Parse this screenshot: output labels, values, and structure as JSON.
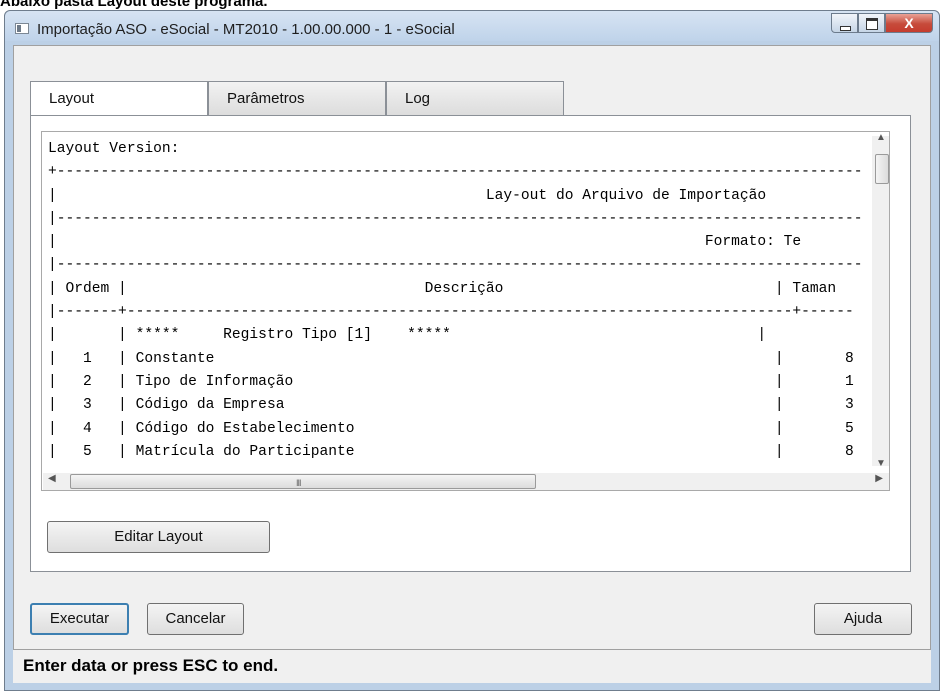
{
  "page": {
    "caption": "Abaixo pasta Layout deste programa."
  },
  "window": {
    "title": "Importação ASO - eSocial - MT2010 - 1.00.00.000 - 1 - eSocial",
    "close_label": "X"
  },
  "tabs": [
    {
      "label": "Layout"
    },
    {
      "label": "Parâmetros"
    },
    {
      "label": "Log"
    }
  ],
  "layout_text": {
    "lines": [
      "Layout Version:",
      "+--------------------------------------------------------------------------------------------",
      "|                                                 Lay-out do Arquivo de Importação",
      "|--------------------------------------------------------------------------------------------",
      "|                                                                          Formato: Te",
      "|--------------------------------------------------------------------------------------------",
      "| Ordem |                                  Descrição                               | Taman",
      "|-------+----------------------------------------------------------------------------+------",
      "|       | *****     Registro Tipo [1]    *****                                   |",
      "|   1   | Constante                                                                |       8",
      "|   2   | Tipo de Informação                                                       |       1",
      "|   3   | Código da Empresa                                                        |       3",
      "|   4   | Código do Estabelecimento                                                |       5",
      "|   5   | Matrícula do Participante                                                |       8"
    ]
  },
  "scrollbars": {
    "grip": "III"
  },
  "buttons": {
    "edit_layout": "Editar Layout",
    "execute": "Executar",
    "cancel": "Cancelar",
    "help": "Ajuda"
  },
  "status": {
    "text": "Enter data or press ESC to end."
  }
}
